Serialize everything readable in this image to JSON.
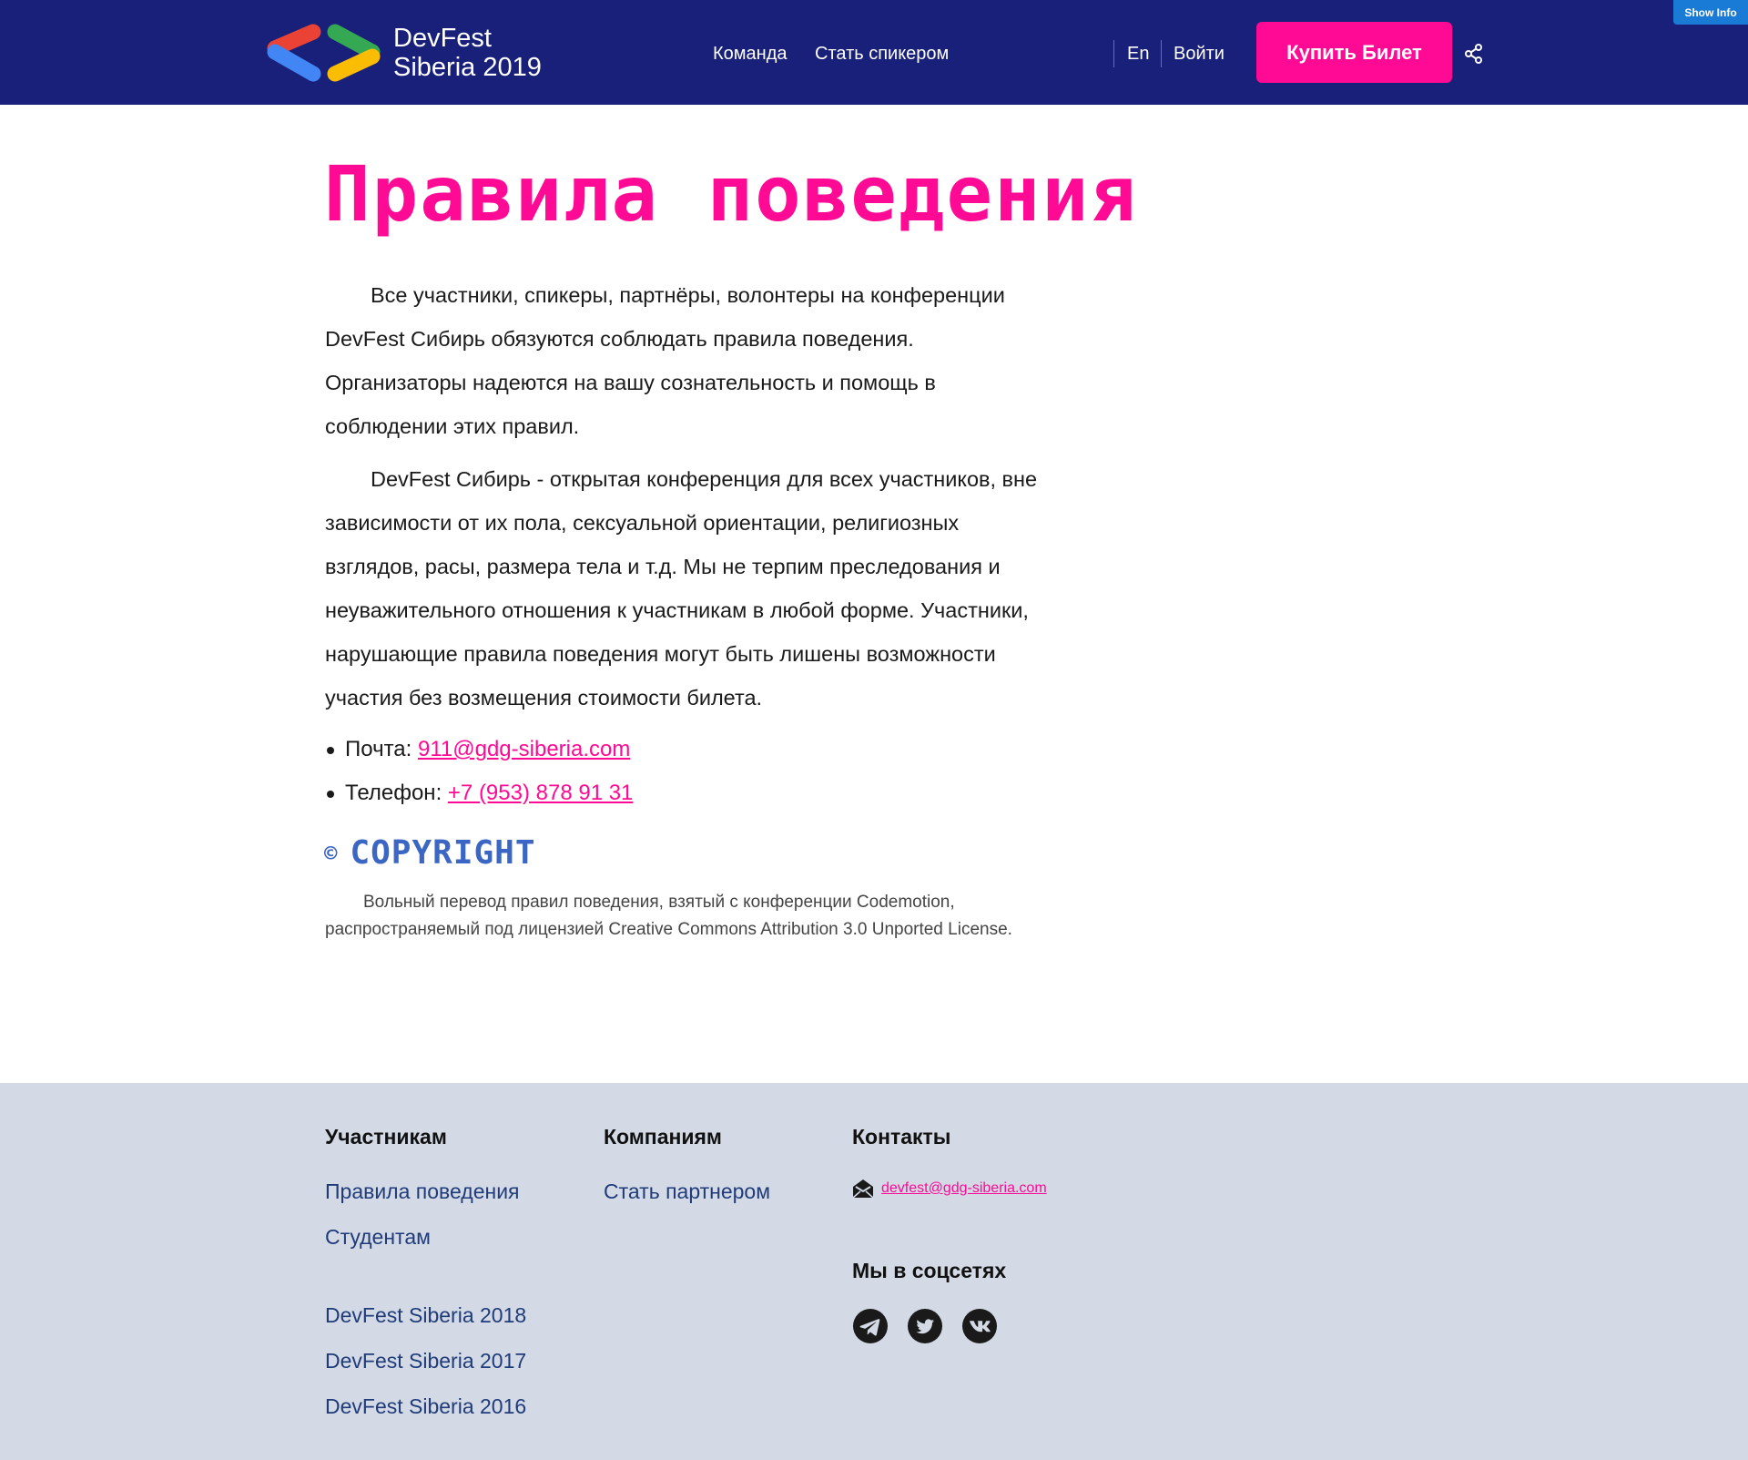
{
  "header": {
    "logo": {
      "line1": "DevFest",
      "line2": "Siberia 2019"
    },
    "nav": {
      "team": "Команда",
      "speaker": "Стать спикером",
      "lang": "En",
      "login": "Войти"
    },
    "buy_label": "Купить Билет",
    "show_info": "Show Info"
  },
  "main": {
    "title": "Правила  поведения",
    "p1": "Все участники, спикеры, партнёры, волонтеры на конференции DevFest Сибирь обязуются соблюдать правила поведения. Организаторы надеются на вашу сознательность и помощь в соблюдении этих правил.",
    "p2": "DevFest Сибирь - открытая конференция для всех участников, вне зависимости от их пола, сексуальной ориентации, религиозных взглядов, расы, размера тела и т.д. Мы не терпим преследования и неуважительного отношения к участникам в любой форме. Участники, нарушающие правила поведения могут быть лишены возможности участия без возмещения стоимости билета.",
    "contacts": [
      {
        "label": "Почта: ",
        "value": "911@gdg-siberia.com"
      },
      {
        "label": "Телефон: ",
        "value": "+7 (953) 878 91 31"
      }
    ],
    "copyright_symbol": "©",
    "copyright_heading": "COPYRIGHT",
    "copyright_text": "Вольный перевод правил поведения, взятый с конференции Codemotion, распространяемый под лицензией Creative Commons Attribution 3.0 Unported License."
  },
  "footer": {
    "participants": {
      "heading": "Участникам",
      "links": [
        "Правила поведения",
        "Студентам",
        "DevFest Siberia 2018",
        "DevFest Siberia 2017",
        "DevFest Siberia 2016"
      ]
    },
    "companies": {
      "heading": "Компаниям",
      "links": [
        "Стать партнером"
      ]
    },
    "contacts": {
      "heading": "Контакты",
      "email": "devfest@gdg-siberia.com"
    },
    "social": {
      "heading": "Мы в соцсетях",
      "icons": [
        "telegram-icon",
        "twitter-icon",
        "vk-icon"
      ]
    }
  },
  "colors": {
    "header_bg": "#182079",
    "accent": "#ff0a94",
    "footer_bg": "#d3dae5",
    "link": "#1f3b7a",
    "copyright": "#3b66c4"
  }
}
